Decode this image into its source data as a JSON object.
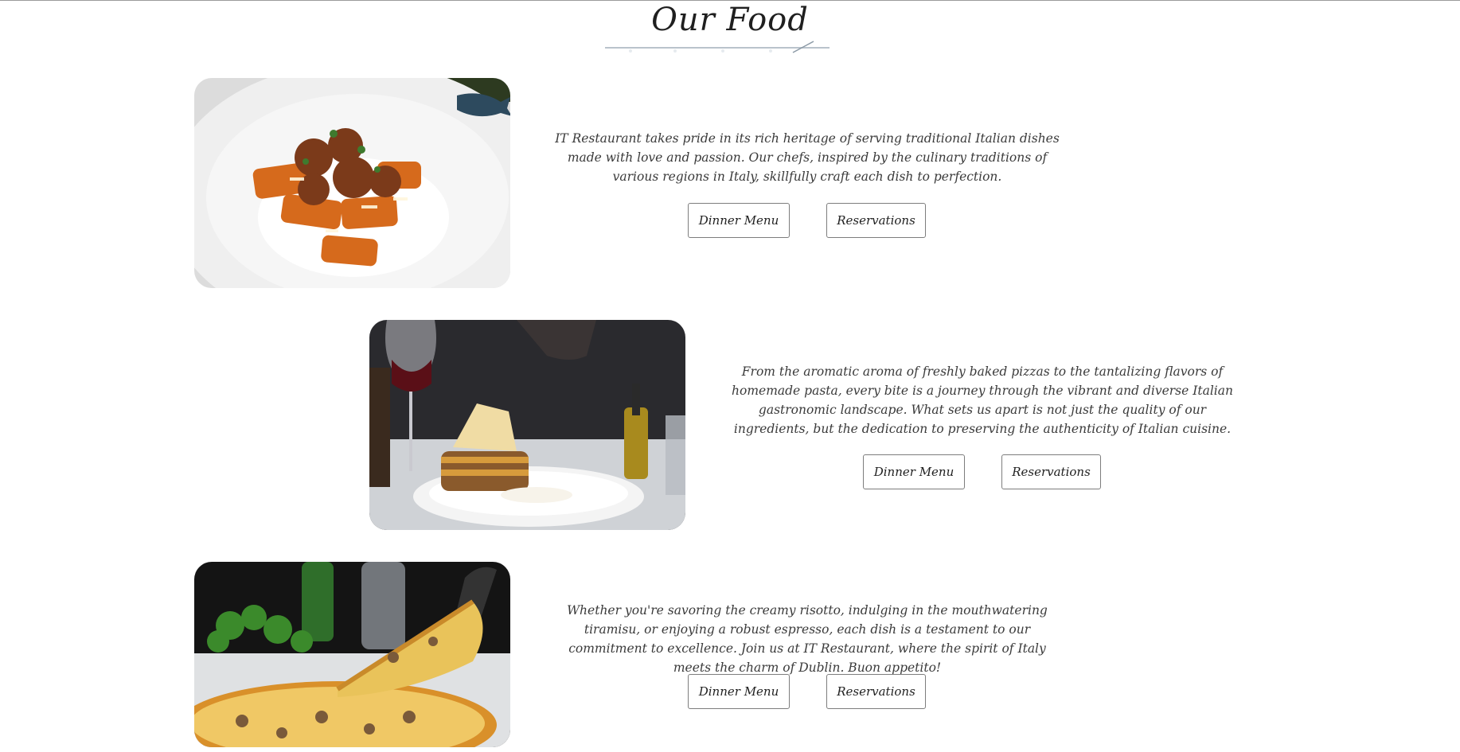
{
  "section": {
    "title": "Our Food"
  },
  "items": [
    {
      "image": "pasta-photo",
      "description": "IT Restaurant takes pride in its rich heritage of serving traditional Italian dishes made with love and passion. Our chefs, inspired by the culinary traditions of various regions in Italy, skillfully craft each dish to perfection.",
      "menu_label": "Dinner Menu",
      "reservations_label": "Reservations"
    },
    {
      "image": "lasagna-photo",
      "description": "From the aromatic aroma of freshly baked pizzas to the tantalizing flavors of homemade pasta, every bite is a journey through the vibrant and diverse Italian gastronomic landscape. What sets us apart is not just the quality of our ingredients, but the dedication to preserving the authenticity of Italian cuisine.",
      "menu_label": "Dinner Menu",
      "reservations_label": "Reservations"
    },
    {
      "image": "pizza-photo",
      "description": "Whether you're savoring the creamy risotto, indulging in the mouthwatering tiramisu, or enjoying a robust espresso, each dish is a testament to our commitment to excellence. Join us at IT Restaurant, where the spirit of Italy meets the charm of Dublin. Buon appetito!",
      "menu_label": "Dinner Menu",
      "reservations_label": "Reservations"
    }
  ]
}
